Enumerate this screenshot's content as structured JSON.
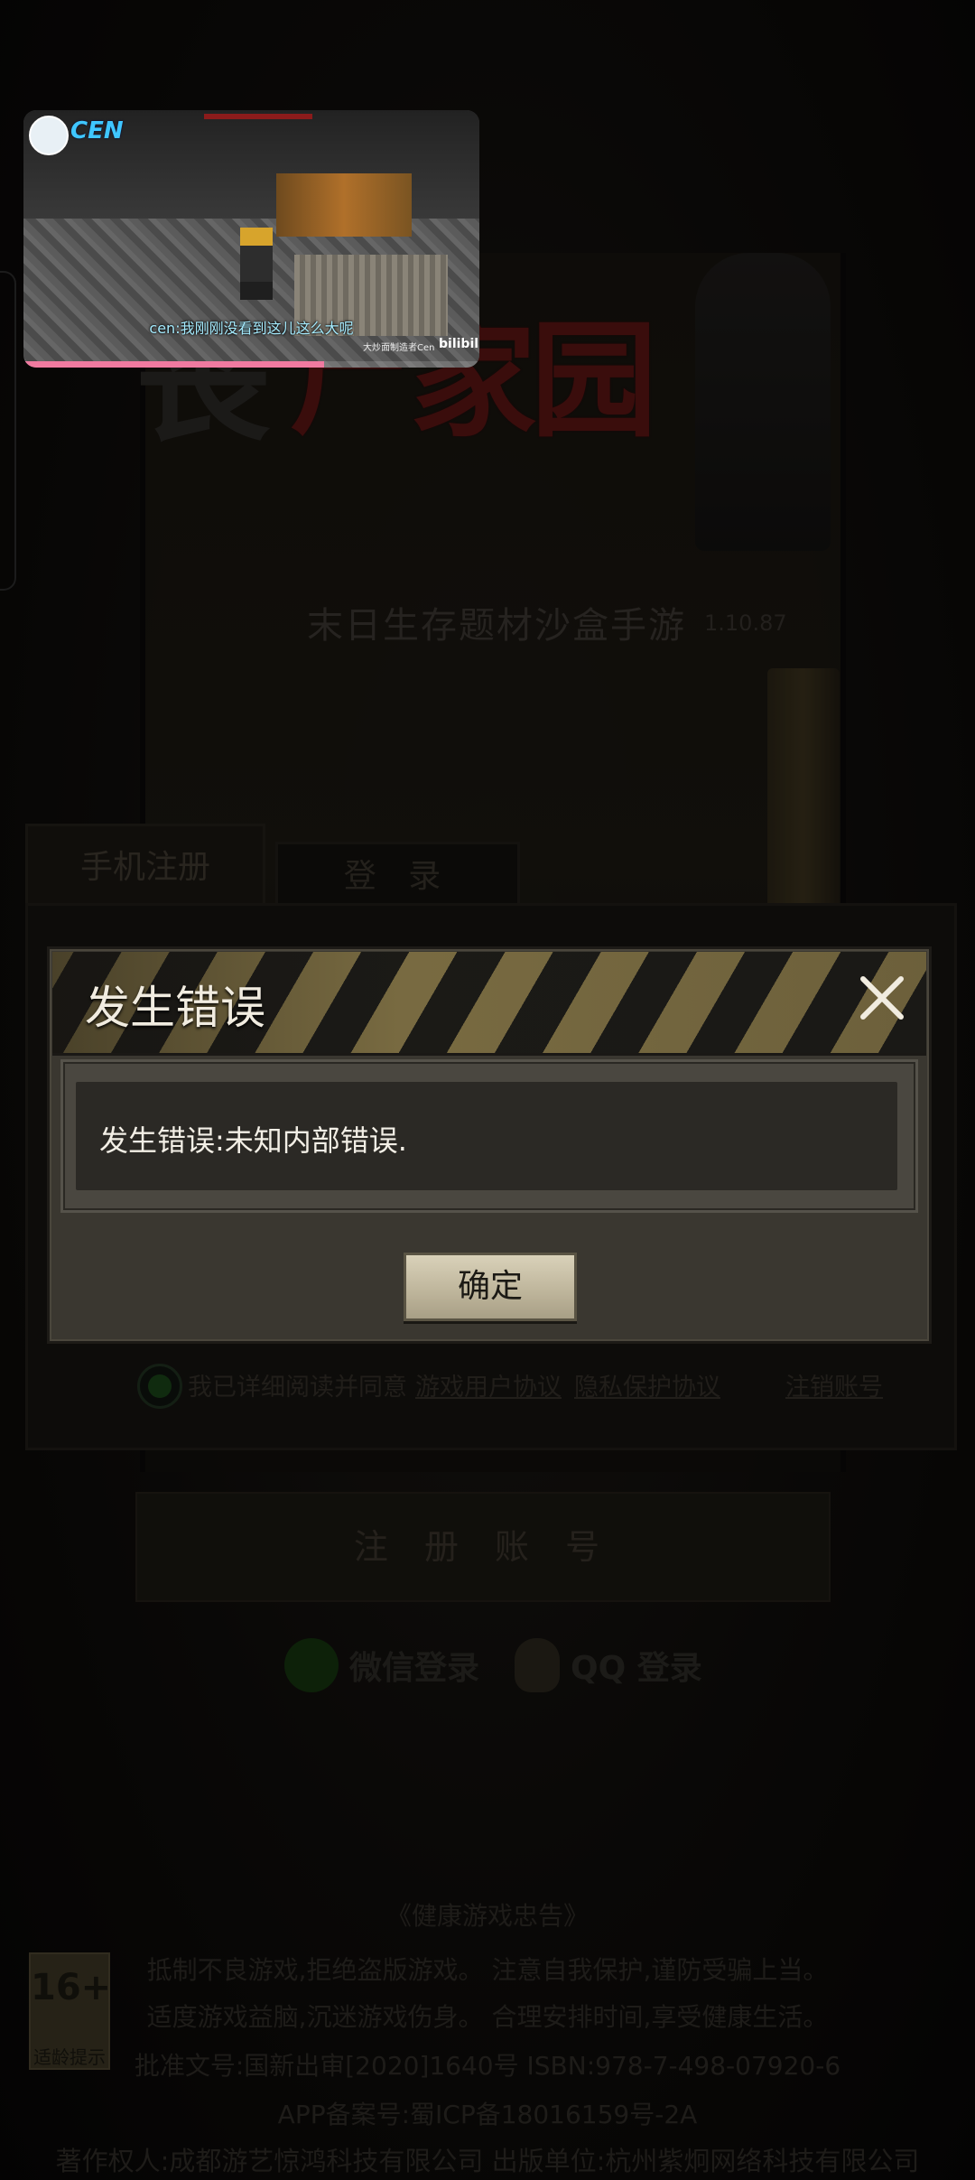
{
  "game": {
    "logo_first_char": "丧",
    "logo_title": "尸家园",
    "tagline": "末日生存题材沙盒手游",
    "version": "1.10.87"
  },
  "tabs": [
    {
      "label": "手机注册"
    },
    {
      "label": "登 录"
    }
  ],
  "agreement": {
    "prefix": "我已详细阅读并同意",
    "link_user": "游戏用户协议",
    "link_privacy": "隐私保护协议",
    "cancel_account": "注销账号"
  },
  "register_button": "注 册 账 号",
  "social": {
    "wechat_label": "微信登录",
    "qq_label": "QQ 登录"
  },
  "footer": {
    "age_badge_number": "16+",
    "age_badge_label": "适龄提示",
    "title": "《健康游戏忠告》",
    "line1": "抵制不良游戏,拒绝盗版游戏。 注意自我保护,谨防受骗上当。",
    "line2": "适度游戏益脑,沉迷游戏伤身。 合理安排时间,享受健康生活。",
    "line3": "批准文号:国新出审[2020]1640号    ISBN:978-7-498-07920-6",
    "line4": "APP备案号:蜀ICP备18016159号-2A",
    "line5": "著作权人:成都游艺惊鸿科技有限公司 出版单位:杭州紫炯网络科技有限公司"
  },
  "dialog": {
    "title": "发生错误",
    "message": "发生错误:未知内部错误.",
    "confirm_label": "确定",
    "close_icon": "close-icon"
  },
  "pip_video": {
    "channel_name": "CEN",
    "subtitle": "cen:我刚刚没看到这儿这么大呢",
    "watermark": "大炒面制造者Cen",
    "platform": "bilibili",
    "progress": 0.66,
    "progress_color": "#f07aa0"
  },
  "colors": {
    "dialog_title": "#f1ece0",
    "hazard_stripe": "#8a7a4a",
    "confirm_button": "#d9d1b9",
    "logo_red": "#5a1413"
  }
}
